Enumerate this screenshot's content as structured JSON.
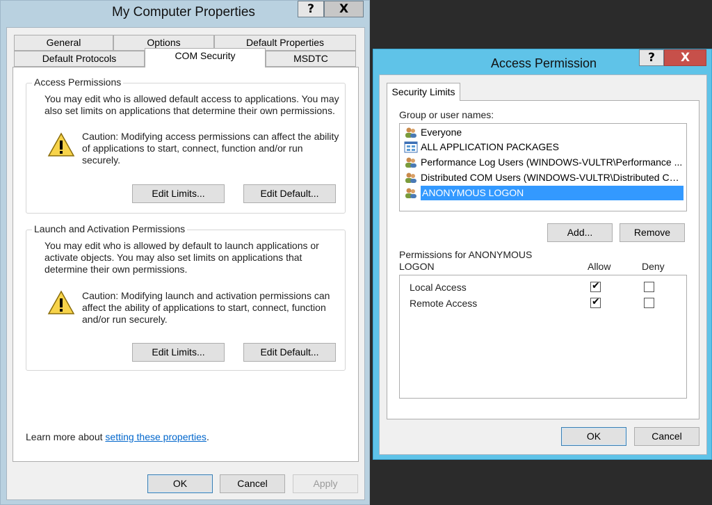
{
  "left_window": {
    "title": "My Computer Properties",
    "help_button": "?",
    "close_button": "X",
    "tabs_row1": [
      "General",
      "Options",
      "Default Properties"
    ],
    "tabs_row2": [
      "Default Protocols",
      "COM Security",
      "MSDTC"
    ],
    "active_tab": "COM Security",
    "access_group": {
      "label": "Access Permissions",
      "description": "You may edit who is allowed default access to applications. You may also set limits on applications that determine their own permissions.",
      "caution": "Caution: Modifying access permissions can affect the ability of applications to start, connect, function and/or run securely.",
      "edit_limits": "Edit Limits...",
      "edit_default": "Edit Default..."
    },
    "launch_group": {
      "label": "Launch and Activation Permissions",
      "description": "You may edit who is allowed by default to launch applications or activate objects. You may also set limits on applications that determine their own permissions.",
      "caution": "Caution: Modifying launch and activation permissions can affect the ability of applications to start, connect, function and/or run securely.",
      "edit_limits": "Edit Limits...",
      "edit_default": "Edit Default..."
    },
    "learn_more_prefix": "Learn more about ",
    "learn_more_link": "setting these properties",
    "learn_more_suffix": ".",
    "ok": "OK",
    "cancel": "Cancel",
    "apply": "Apply"
  },
  "right_window": {
    "title": "Access Permission",
    "help_button": "?",
    "close_button": "X",
    "tab": "Security Limits",
    "group_label": "Group or user names:",
    "users": [
      {
        "name": "Everyone",
        "icon": "users-group-icon"
      },
      {
        "name": "ALL APPLICATION PACKAGES",
        "icon": "app-packages-icon"
      },
      {
        "name": "Performance Log Users (WINDOWS-VULTR\\Performance ...",
        "icon": "users-group-icon"
      },
      {
        "name": "Distributed COM Users (WINDOWS-VULTR\\Distributed CO...",
        "icon": "users-group-icon"
      },
      {
        "name": "ANONYMOUS LOGON",
        "icon": "users-group-icon",
        "selected": true
      }
    ],
    "add": "Add...",
    "remove": "Remove",
    "permissions_label_line1": "Permissions for ANONYMOUS",
    "permissions_label_line2": "LOGON",
    "allow_header": "Allow",
    "deny_header": "Deny",
    "permissions": [
      {
        "name": "Local Access",
        "allow": true,
        "deny": false
      },
      {
        "name": "Remote Access",
        "allow": true,
        "deny": false
      }
    ],
    "ok": "OK",
    "cancel": "Cancel"
  },
  "colors": {
    "left_frame": "#b9d1e0",
    "right_frame": "#5fc3e8",
    "selection": "#3399ff",
    "link": "#0066cc",
    "close_red": "#c7504a"
  }
}
